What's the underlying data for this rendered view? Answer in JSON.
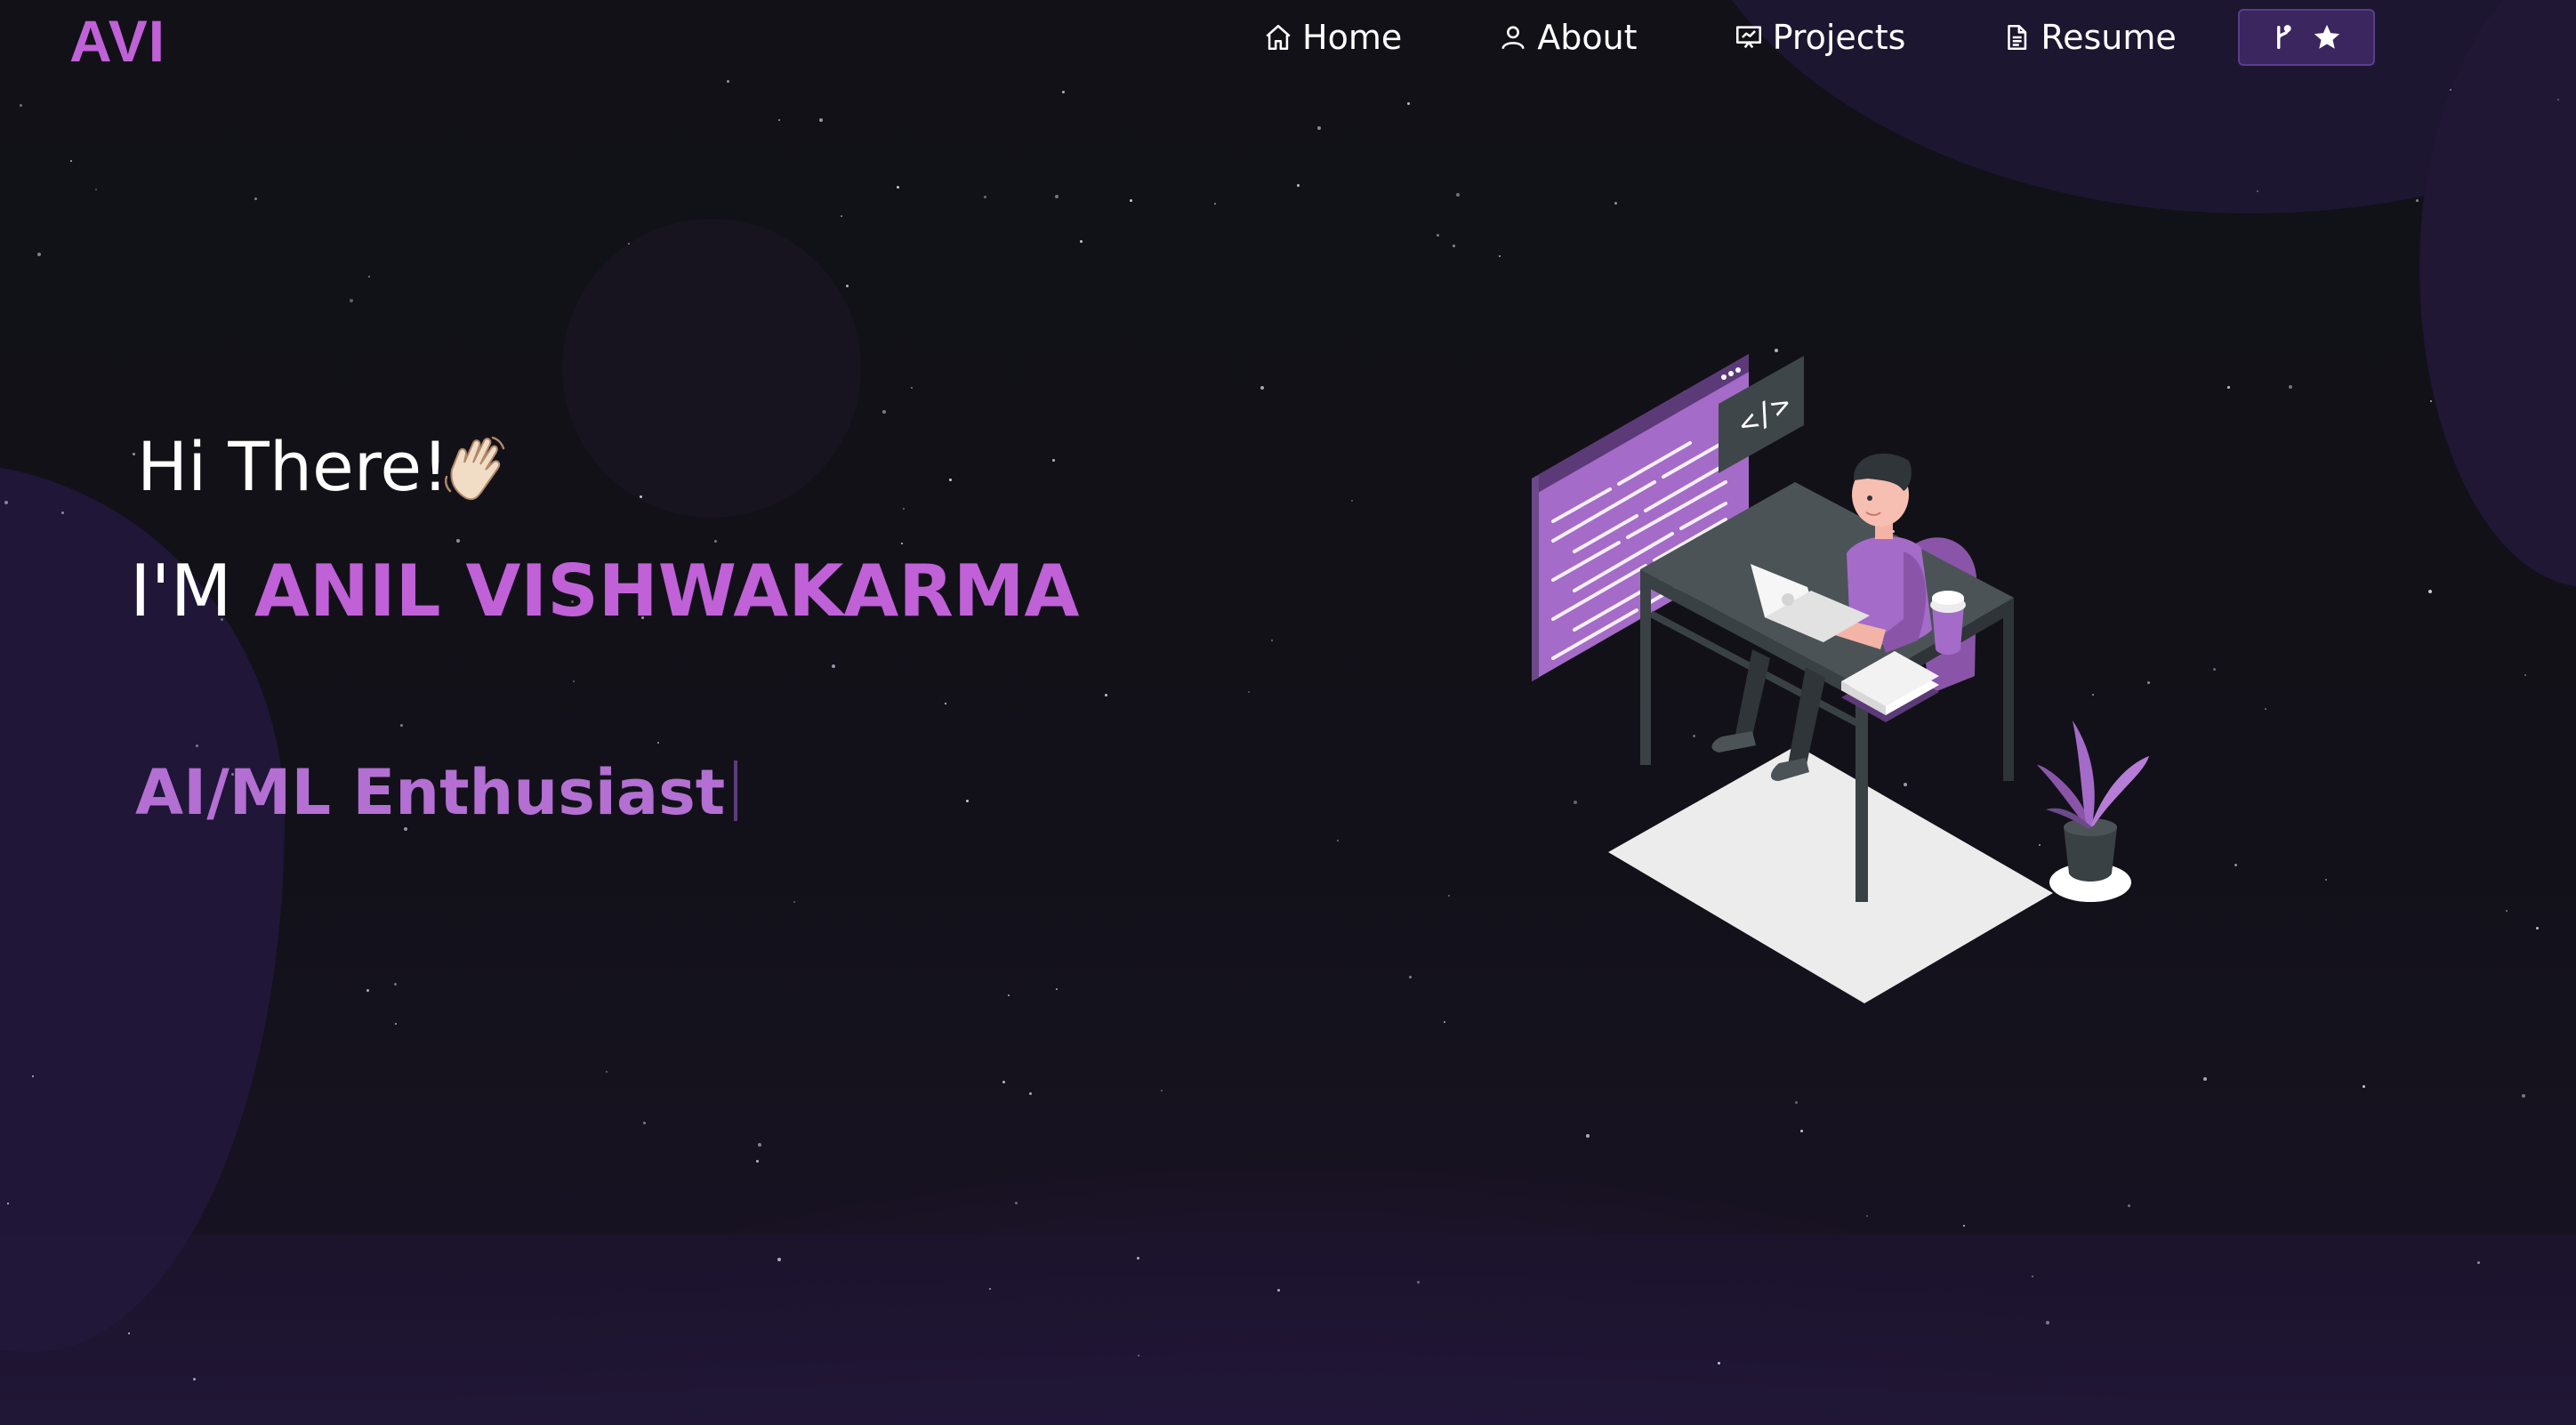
{
  "navbar": {
    "brand": "AVI",
    "items": [
      {
        "label": "Home",
        "icon": "home-icon"
      },
      {
        "label": "About",
        "icon": "user-icon"
      },
      {
        "label": "Projects",
        "icon": "presentation-icon"
      },
      {
        "label": "Resume",
        "icon": "document-icon"
      }
    ],
    "github_button": {
      "icons": [
        "git-fork-icon",
        "star-icon"
      ]
    }
  },
  "hero": {
    "greeting": "Hi There!",
    "greeting_emoji": "waving-hand-icon",
    "intro_prefix": "I'M",
    "name": "ANIL VISHWAKARMA",
    "typewriter_text": "AI/ML Enthusiast"
  },
  "colors": {
    "background": "#111117",
    "accent": "#c061d8",
    "button_bg": "#3b2660"
  }
}
